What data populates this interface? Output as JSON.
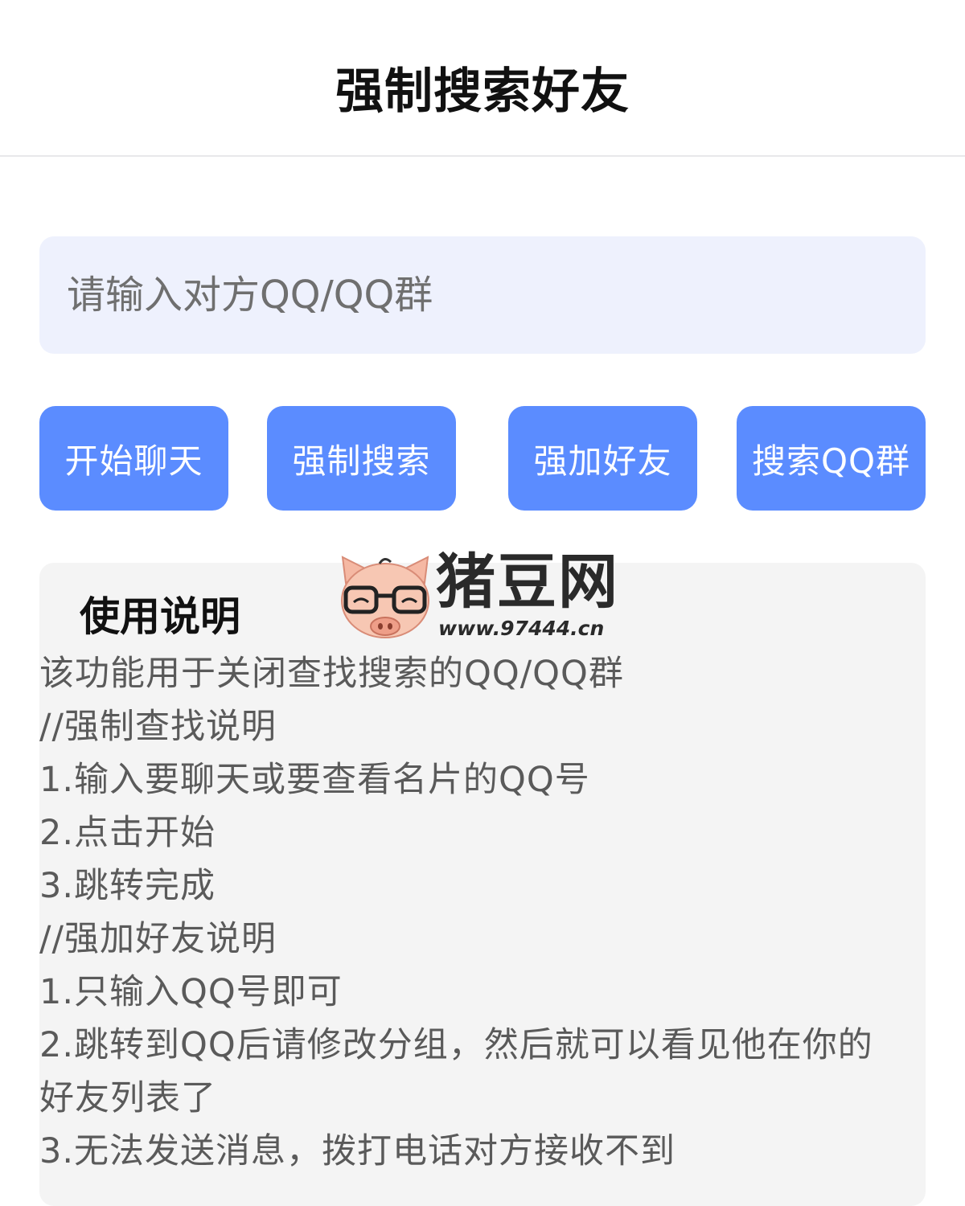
{
  "header": {
    "title": "强制搜索好友"
  },
  "search": {
    "placeholder": "请输入对方QQ/QQ群"
  },
  "actions": [
    {
      "label": "开始聊天"
    },
    {
      "label": "强制搜索"
    },
    {
      "label": "强加好友"
    },
    {
      "label": "搜索QQ群"
    }
  ],
  "instructions": {
    "title": "使用说明",
    "lines": [
      "该功能用于关闭查找搜索的QQ/QQ群",
      "//强制查找说明",
      "1.输入要聊天或要查看名片的QQ号",
      "2.点击开始",
      "3.跳转完成",
      "//强加好友说明",
      "1.只输入QQ号即可",
      "2.跳转到QQ后请修改分组，然后就可以看见他在你的",
      "好友列表了",
      "3.无法发送消息，拨打电话对方接收不到"
    ]
  },
  "watermark": {
    "logo_text": "猪豆网",
    "url": "www.97444.cn",
    "icon": "pig-mascot-icon"
  },
  "colors": {
    "button_blue": "#5b8cff",
    "input_bg": "#eef1fd",
    "panel_bg": "#f4f4f4"
  }
}
